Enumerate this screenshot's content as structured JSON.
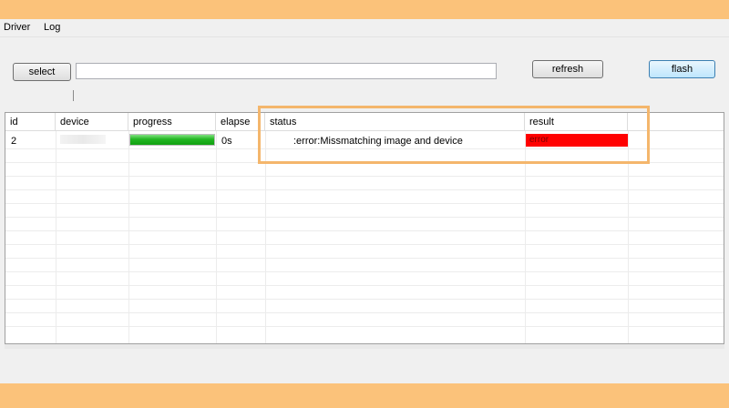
{
  "menu": {
    "items": [
      "Driver",
      "Log"
    ]
  },
  "toolbar": {
    "select_label": "select",
    "path_value": "",
    "refresh_label": "refresh",
    "flash_label": "flash"
  },
  "table": {
    "columns": [
      "id",
      "device",
      "progress",
      "elapse",
      "status",
      "result"
    ],
    "rows": [
      {
        "id": "2",
        "device": "",
        "progress": 1.0,
        "elapse": "0s",
        "status": ":error:Missmatching image and device",
        "result": "error"
      }
    ]
  },
  "colors": {
    "banner": "#fbc27a",
    "progress": "#22b622",
    "error": "#ff0000",
    "highlight": "#f4b66c",
    "focus_button": "#bee6fd"
  }
}
